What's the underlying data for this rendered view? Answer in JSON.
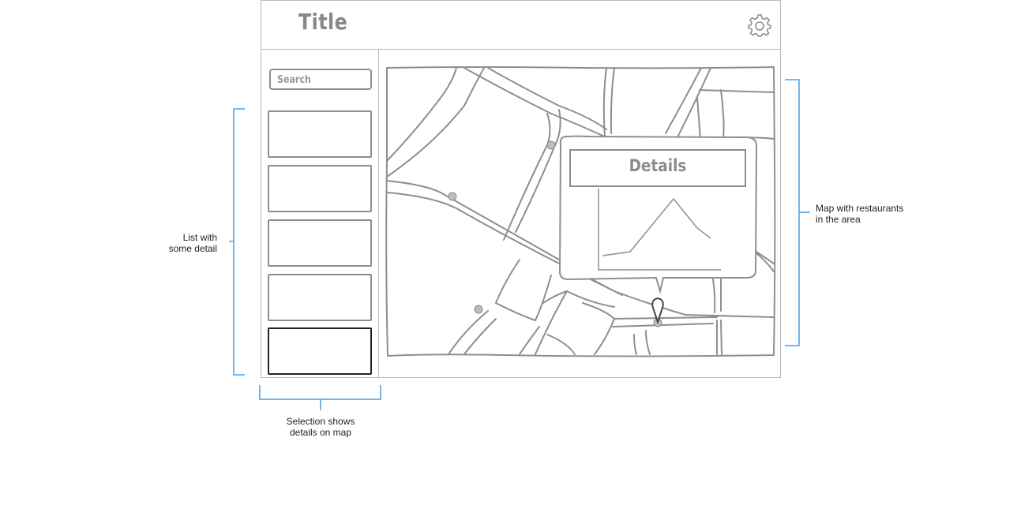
{
  "app": {
    "title": "Title",
    "settings_icon": "gear-icon"
  },
  "sidebar": {
    "search_placeholder": "Search",
    "list_items": [
      {
        "selected": false
      },
      {
        "selected": false
      },
      {
        "selected": false
      },
      {
        "selected": false
      },
      {
        "selected": true
      }
    ]
  },
  "map": {
    "popup_title": "Details",
    "marker_icon": "map-pin-icon"
  },
  "annotations": {
    "list": "List with\nsome detail",
    "selection": "Selection shows\ndetails on map",
    "map": "Map with restaurants\nin the area"
  },
  "colors": {
    "annotation_bracket": "#4a9fe6",
    "sketch_line": "#8e8e8e",
    "frame_border": "#b8bcc2",
    "selected_border": "#222222"
  }
}
